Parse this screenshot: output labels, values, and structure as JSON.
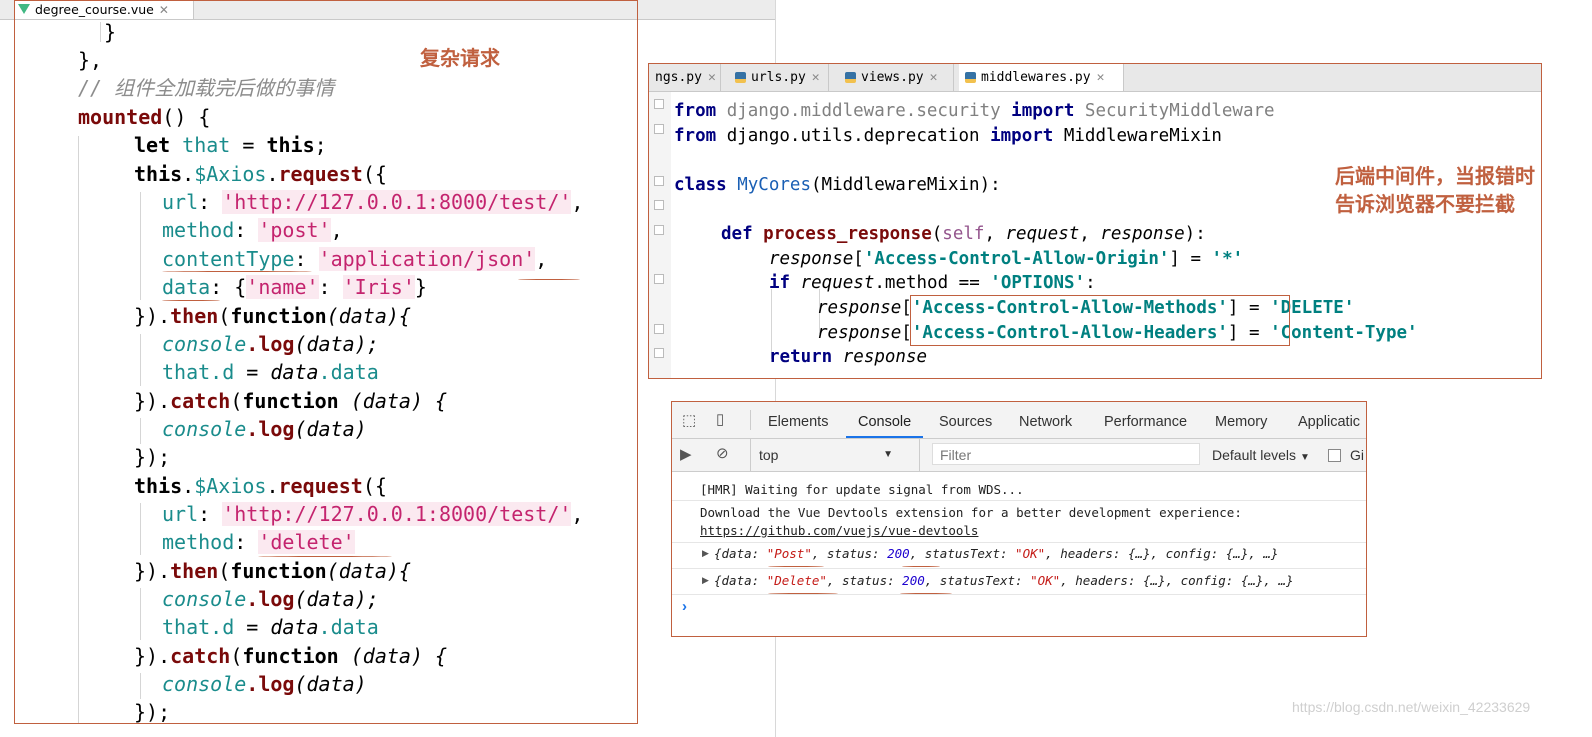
{
  "left_editor": {
    "tab_label": "degree_course.vue",
    "annotation": "复杂请求",
    "lines": {
      "l0": "}",
      "l1": "},",
      "l2": "// 组件全加载完后做的事情",
      "l3_fn": "mounted",
      "l3_rest": "() {",
      "l4_kw": "let",
      "l4_var": "that",
      "l4_eq": " = ",
      "l4_this": "this",
      "l4_semi": ";",
      "l5_this": "this",
      "l5_dot": ".",
      "l5_axios": "$Axios",
      "l5_req": "request",
      "l5_rest": "({",
      "l6_key": "url",
      "l6_colon": ": ",
      "l6_val": "'http://127.0.0.1:8000/test/'",
      "l6_end": ",",
      "l7_key": "method",
      "l7_colon": ": ",
      "l7_val": "'post'",
      "l7_end": ",",
      "l8_key": "contentType",
      "l8_colon": ": ",
      "l8_val": "'application/json'",
      "l8_end": ",",
      "l9_key": "data",
      "l9_colon": ": {",
      "l9_k": "'name'",
      "l9_c": ": ",
      "l9_v": "'Iris'",
      "l9_end": "}",
      "l10_pre": "}).",
      "l10_then": "then",
      "l10_open": "(",
      "l10_fn": "function",
      "l10_arg": "(data){",
      "l11_console": "console",
      "l11_log": ".log",
      "l11_arg": "(data);",
      "l12_that": "that.d",
      "l12_eq": " = ",
      "l12_data": "data",
      "l12_dd": ".data",
      "l13_pre": "}).",
      "l13_catch": "catch",
      "l13_open": "(",
      "l13_fn": "function",
      "l13_arg": " (data) {",
      "l14_console": "console",
      "l14_log": ".log",
      "l14_arg": "(data)",
      "l15": "});",
      "l16_this": "this",
      "l16_dot": ".",
      "l16_axios": "$Axios",
      "l16_req": "request",
      "l16_rest": "({",
      "l17_key": "url",
      "l17_colon": ": ",
      "l17_val": "'http://127.0.0.1:8000/test/'",
      "l17_end": ",",
      "l18_key": "method",
      "l18_colon": ": ",
      "l18_val": "'delete'",
      "l19_pre": "}).",
      "l19_then": "then",
      "l19_open": "(",
      "l19_fn": "function",
      "l19_arg": "(data){",
      "l20_console": "console",
      "l20_log": ".log",
      "l20_arg": "(data);",
      "l21_that": "that.d",
      "l21_eq": " = ",
      "l21_data": "data",
      "l21_dd": ".data",
      "l22_pre": "}).",
      "l22_catch": "catch",
      "l22_open": "(",
      "l22_fn": "function",
      "l22_arg": " (data) {",
      "l23_console": "console",
      "l23_log": ".log",
      "l23_arg": "(data)",
      "l24": "});"
    }
  },
  "py_editor": {
    "tabs": [
      "ngs.py",
      "urls.py",
      "views.py",
      "middlewares.py"
    ],
    "annotation_line1": "后端中间件，当报错时",
    "annotation_line2": "告诉浏览器不要拦截",
    "lines": {
      "p1_from": "from",
      "p1_mod": " django.middleware.security ",
      "p1_imp": "import",
      "p1_name": " SecurityMiddleware",
      "p2_from": "from",
      "p2_mod": " django.utils.deprecation ",
      "p2_imp": "import",
      "p2_name": " MiddlewareMixin",
      "p3_class": "class",
      "p3_name": "MyCores",
      "p3_rest": "(MiddlewareMixin):",
      "p4_def": "def",
      "p4_name": "process_response",
      "p4_open": "(",
      "p4_self": "self",
      "p4_c1": ", ",
      "p4_req": "request",
      "p4_c2": ", ",
      "p4_resp": "response",
      "p4_end": "):",
      "p5_resp": "response",
      "p5_open": "[",
      "p5_key": "'Access-Control-Allow-Origin'",
      "p5_eq": "] = ",
      "p5_val": "'*'",
      "p6_if": "if",
      "p6_req": " request",
      "p6_rest": ".method == ",
      "p6_val": "'OPTIONS'",
      "p6_end": ":",
      "p7_resp": "response",
      "p7_open": "[",
      "p7_key": "'Access-Control-Allow-Methods'",
      "p7_eq": "] = ",
      "p7_val": "'DELETE'",
      "p8_resp": "response",
      "p8_open": "[",
      "p8_key": "'Access-Control-Allow-Headers'",
      "p8_eq": "] = ",
      "p8_val": "'Content-Type'",
      "p9_ret": "return",
      "p9_resp": " response"
    }
  },
  "devtools": {
    "tabs": [
      "Elements",
      "Console",
      "Sources",
      "Network",
      "Performance",
      "Memory",
      "Applicatic"
    ],
    "active_tab": "Console",
    "context": "top",
    "filter_placeholder": "Filter",
    "levels": "Default levels",
    "group_label": "Gi",
    "messages": {
      "m1": "[HMR] Waiting for update signal from WDS...",
      "m2": "Download the Vue Devtools extension for a better development experience:",
      "m2_link": "https://github.com/vuejs/vue-devtools",
      "o1_a": "{data: ",
      "o1_data": "\"Post\"",
      "o1_b": ", status: ",
      "o1_status": "200",
      "o1_c": ", statusText: ",
      "o1_st": "\"OK\"",
      "o1_d": ", headers: {…}, config: {…}, …}",
      "o2_a": "{data: ",
      "o2_data": "\"Delete\"",
      "o2_b": ", status: ",
      "o2_status": "200",
      "o2_c": ", statusText: ",
      "o2_st": "\"OK\"",
      "o2_d": ", headers: {…}, config: {…}, …}"
    }
  },
  "watermark": "https://blog.csdn.net/weixin_42233629",
  "colors": {
    "annotation": "#c0603f",
    "active_tab_underline": "#1a73e8"
  }
}
